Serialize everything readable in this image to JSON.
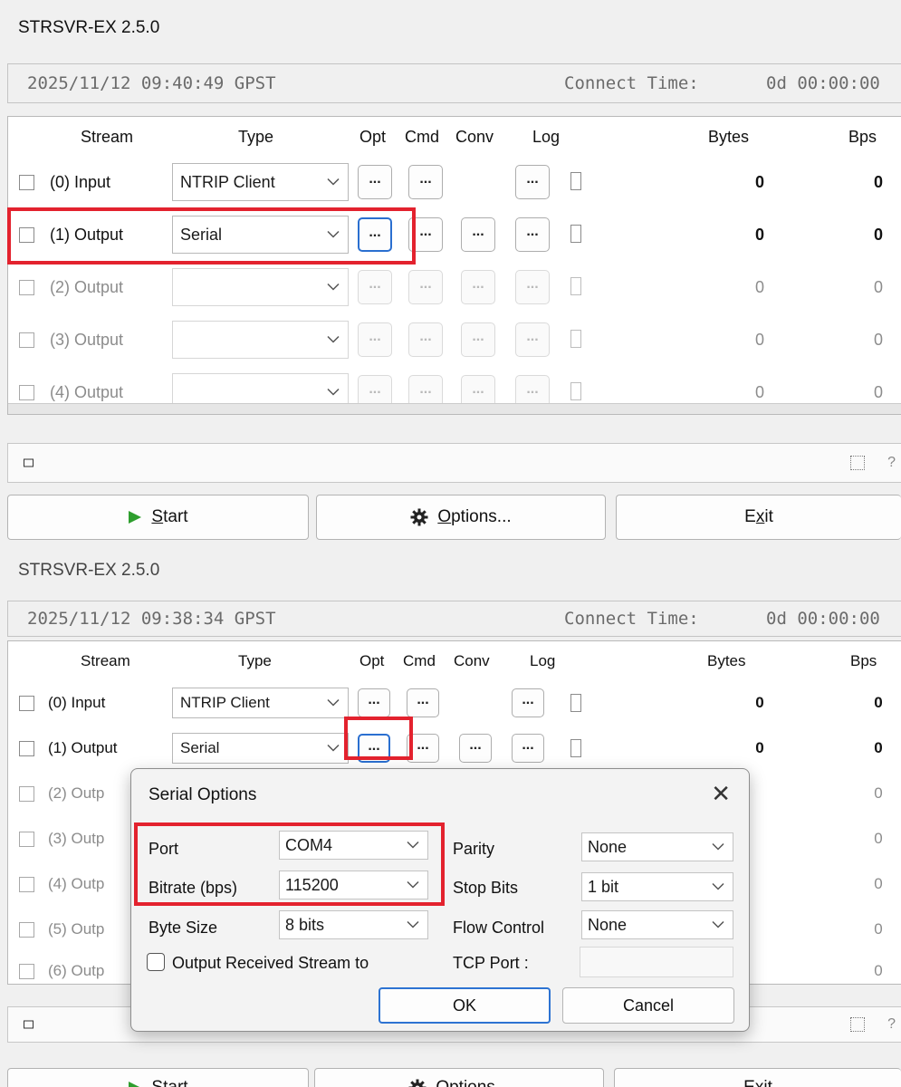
{
  "top": {
    "title": "STRSVR-EX 2.5.0",
    "time": "2025/11/12 09:40:49 GPST",
    "connect_label": "Connect Time:",
    "connect_value": "0d 00:00:00",
    "headers": {
      "stream": "Stream",
      "type": "Type",
      "opt": "Opt",
      "cmd": "Cmd",
      "conv": "Conv",
      "log": "Log",
      "bytes": "Bytes",
      "bps": "Bps"
    },
    "rows": [
      {
        "label": "(0) Input",
        "type": "NTRIP Client",
        "opt": "...",
        "cmd": "...",
        "log": "...",
        "bytes": "0",
        "bps": "0"
      },
      {
        "label": "(1) Output",
        "type": "Serial",
        "opt": "...",
        "cmd": "...",
        "conv": "...",
        "log": "...",
        "bytes": "0",
        "bps": "0"
      },
      {
        "label": "(2) Output",
        "type": "",
        "opt": "...",
        "cmd": "...",
        "conv": "...",
        "log": "...",
        "bytes": "0",
        "bps": "0"
      },
      {
        "label": "(3) Output",
        "type": "",
        "opt": "...",
        "cmd": "...",
        "conv": "...",
        "log": "...",
        "bytes": "0",
        "bps": "0"
      },
      {
        "label": "(4) Output",
        "type": "",
        "opt": "...",
        "cmd": "...",
        "conv": "...",
        "log": "...",
        "bytes": "0",
        "bps": "0"
      }
    ],
    "qmark": "?",
    "buttons": {
      "start_prefix": "S",
      "start_rest": "tart",
      "options_prefix": "O",
      "options_rest": "ptions...",
      "exit_pre": "E",
      "exit_ul": "x",
      "exit_post": "it"
    }
  },
  "bottom": {
    "title": "STRSVR-EX 2.5.0",
    "time": "2025/11/12 09:38:34 GPST",
    "connect_label": "Connect Time:",
    "connect_value": "0d 00:00:00",
    "headers": {
      "stream": "Stream",
      "type": "Type",
      "opt": "Opt",
      "cmd": "Cmd",
      "conv": "Conv",
      "log": "Log",
      "bytes": "Bytes",
      "bps": "Bps"
    },
    "rows": [
      {
        "label": "(0) Input",
        "type": "NTRIP Client",
        "opt": "...",
        "cmd": "...",
        "log": "...",
        "bytes": "0",
        "bps": "0"
      },
      {
        "label": "(1) Output",
        "type": "Serial",
        "opt": "...",
        "cmd": "...",
        "conv": "...",
        "log": "...",
        "bytes": "0",
        "bps": "0"
      },
      {
        "label": "(2) Outp",
        "bps": "0"
      },
      {
        "label": "(3) Outp",
        "bps": "0"
      },
      {
        "label": "(4) Outp",
        "bps": "0"
      },
      {
        "label": "(5) Outp",
        "bps": "0"
      },
      {
        "label": "(6) Outp",
        "bps": "0"
      }
    ],
    "qmark": "?",
    "buttons": {
      "start_prefix": "S",
      "start_rest": "tart",
      "options_prefix": "O",
      "options_rest": "ptions...",
      "exit_pre": "E",
      "exit_ul": "x",
      "exit_post": "it"
    }
  },
  "dialog": {
    "title": "Serial Options",
    "close": "✕",
    "port_label": "Port",
    "port_value": "COM4",
    "bitrate_label": "Bitrate (bps)",
    "bitrate_value": "115200",
    "bytesize_label": "Byte Size",
    "bytesize_value": "8 bits",
    "parity_label": "Parity",
    "parity_value": "None",
    "stopbits_label": "Stop Bits",
    "stopbits_value": "1 bit",
    "flow_label": "Flow Control",
    "flow_value": "None",
    "output_check_label": "Output Received Stream to",
    "tcp_label": "TCP Port :",
    "tcp_value": "",
    "ok": "OK",
    "cancel": "Cancel"
  },
  "colors": {
    "highlight": "#e3222e",
    "focus": "#2a6fd0",
    "play": "#2e9e2e"
  },
  "icons": [
    "chevron-down-icon",
    "play-icon",
    "gear-icon",
    "close-icon"
  ]
}
